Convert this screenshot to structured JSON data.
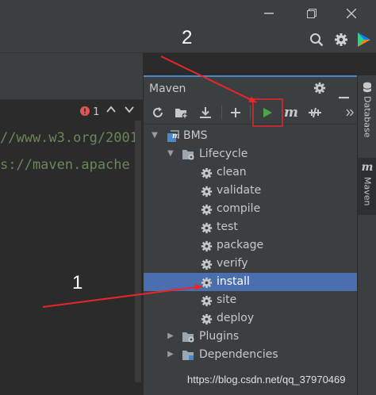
{
  "window": {
    "minimize_icon": "minimize-icon",
    "restore_icon": "restore-icon",
    "close_icon": "close-icon"
  },
  "toolbar": {
    "icons": [
      "search-icon",
      "gear-icon",
      "jetbrains-toolbox-icon"
    ]
  },
  "annotations": {
    "label_1": "1",
    "label_2": "2",
    "arrow_color": "#e8262a",
    "highlight_color": "#e8262a"
  },
  "editor": {
    "lines": [
      "//www.w3.org/2001",
      "s://maven.apache"
    ],
    "inspection_count": "1",
    "inspection_icon": "error-icon",
    "nav_icons": [
      "chevron-up-icon",
      "chevron-down-icon"
    ]
  },
  "maven_panel": {
    "title": "Maven",
    "header_icons": [
      "gear-icon",
      "minimize-icon"
    ],
    "toolbar_icons": [
      "reload-icon",
      "add-folder-icon",
      "download-icon",
      "add-icon",
      "run-icon",
      "maven-m-icon",
      "skip-tests-icon",
      "more-icon"
    ],
    "tree": {
      "project": "BMS",
      "lifecycle": "Lifecycle",
      "goals": [
        "clean",
        "validate",
        "compile",
        "test",
        "package",
        "verify",
        "install",
        "site",
        "deploy"
      ],
      "selected_goal": "install",
      "plugins": "Plugins",
      "dependencies": "Dependencies"
    }
  },
  "side_tabs": {
    "database": "Database",
    "maven": "Maven"
  },
  "watermark": "https://blog.csdn.net/qq_37970469",
  "colors": {
    "selection": "#4b6eaf",
    "run_green": "#4fa34a",
    "code_string": "#6a8759"
  }
}
